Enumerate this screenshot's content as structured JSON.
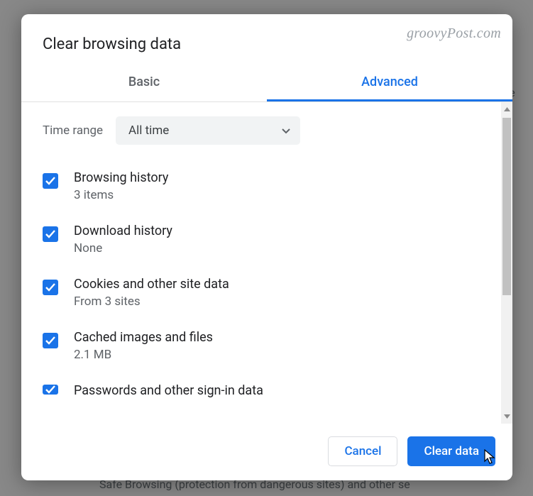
{
  "watermark": "groovyPost.com",
  "dialog": {
    "title": "Clear browsing data",
    "tabs": {
      "basic": "Basic",
      "advanced": "Advanced"
    },
    "time": {
      "label": "Time range",
      "value": "All time"
    },
    "items": [
      {
        "title": "Browsing history",
        "sub": "3 items",
        "checked": true
      },
      {
        "title": "Download history",
        "sub": "None",
        "checked": true
      },
      {
        "title": "Cookies and other site data",
        "sub": "From 3 sites",
        "checked": true
      },
      {
        "title": "Cached images and files",
        "sub": "2.1 MB",
        "checked": true
      },
      {
        "title": "Passwords and other sign-in data",
        "sub": "",
        "checked": true
      }
    ],
    "buttons": {
      "cancel": "Cancel",
      "clear": "Clear data"
    }
  },
  "background": {
    "te": "te",
    "safe": "Safe Browsing (protection from dangerous sites) and other se"
  }
}
